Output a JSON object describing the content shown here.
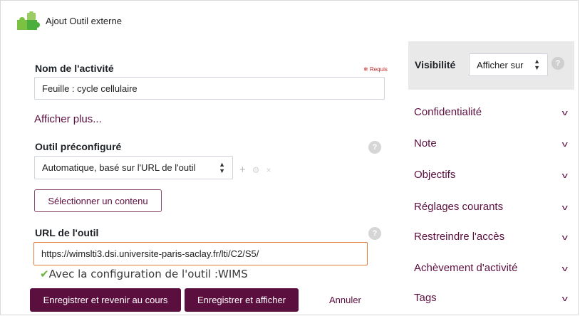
{
  "header": {
    "title": "Ajout Outil externe",
    "icon": "puzzle-icon"
  },
  "form": {
    "name_label": "Nom de l'activité",
    "required_text": "Requis",
    "name_value": "Feuille : cycle cellulaire",
    "show_more": "Afficher plus...",
    "preconfig_label": "Outil préconfiguré",
    "preconfig_value": "Automatique, basé sur l'URL de l'outil",
    "select_content": "Sélectionner un contenu",
    "url_label": "URL de l'outil",
    "url_value": "https://wimslti3.dsi.universite-paris-saclay.fr/lti/C2/S5/",
    "config_note": "Avec la configuration de l'outil :WIMS"
  },
  "buttons": {
    "save_return": "Enregistrer et revenir au cours",
    "save_show": "Enregistrer et afficher",
    "cancel": "Annuler"
  },
  "sidebar": {
    "visibility_label": "Visibilité",
    "visibility_value": "Afficher sur",
    "sections": [
      {
        "label": "Confidentialité"
      },
      {
        "label": "Note"
      },
      {
        "label": "Objectifs"
      },
      {
        "label": "Réglages courants"
      },
      {
        "label": "Restreindre l'accès"
      },
      {
        "label": "Achèvement d'activité"
      },
      {
        "label": "Tags"
      }
    ]
  },
  "colors": {
    "brand": "#5b0f3e",
    "panel": "#e9e9e9",
    "focus_border": "#e07b39",
    "check": "#6db33f"
  }
}
